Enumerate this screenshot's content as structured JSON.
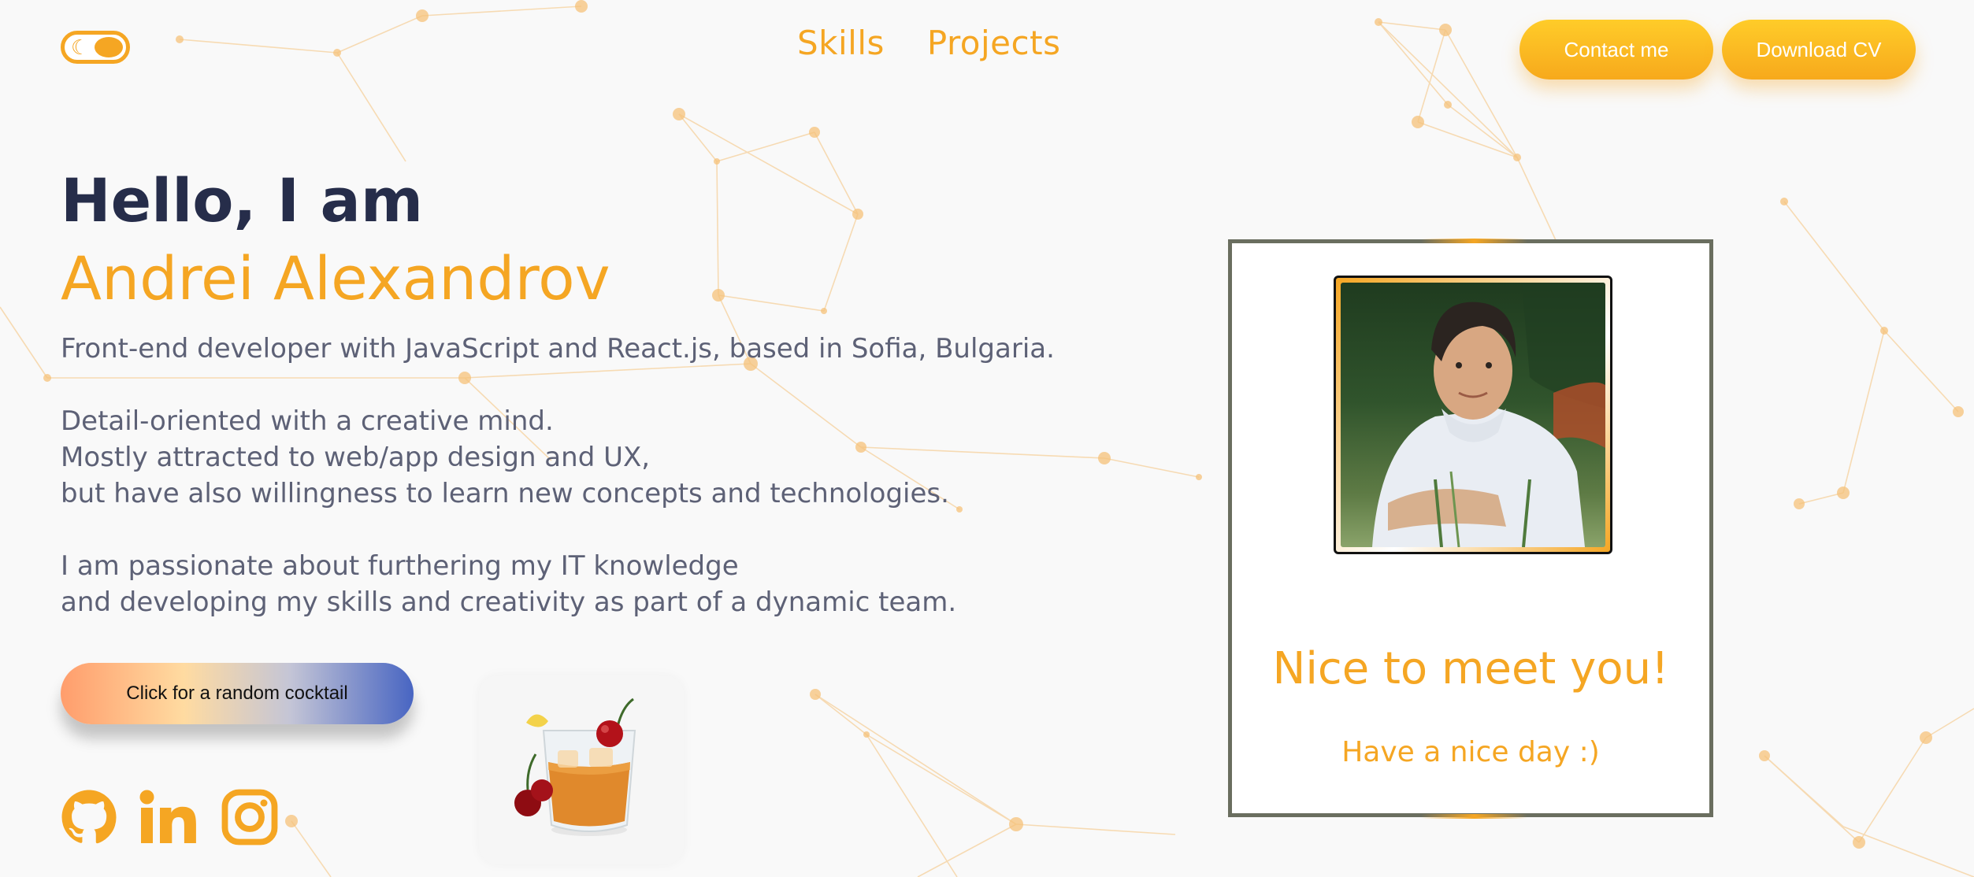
{
  "header": {
    "theme_toggle": {
      "icon": "moon-icon",
      "state": "light"
    },
    "nav": [
      {
        "label": "Skills"
      },
      {
        "label": "Projects"
      }
    ],
    "contact_label": "Contact me",
    "download_label": "Download CV"
  },
  "hero": {
    "greeting": "Hello, I am",
    "name": "Andrei Alexandrov",
    "lines": [
      "Front-end developer with JavaScript and React.js, based in Sofia, Bulgaria.",
      "Detail-oriented with a creative mind.",
      "Mostly attracted to web/app design and UX,",
      "but have also willingness to learn new concepts and technologies.",
      "I am passionate about furthering my IT knowledge",
      "and developing my skills and creativity as part of a dynamic team."
    ],
    "cocktail_button_label": "Click for a random cocktail",
    "cocktail_image": "cocktail-glass-with-cherries"
  },
  "social": [
    {
      "icon": "github-icon"
    },
    {
      "icon": "linkedin-icon"
    },
    {
      "icon": "instagram-icon"
    }
  ],
  "card": {
    "photo": "profile-photo",
    "title": "Nice to meet you!",
    "subtitle": "Have a nice day :)"
  },
  "colors": {
    "accent": "#f5a623",
    "heading": "#262d4a",
    "body_text": "#5d6176",
    "background": "#f9f9f9",
    "card_border": "#6a6e5f"
  }
}
